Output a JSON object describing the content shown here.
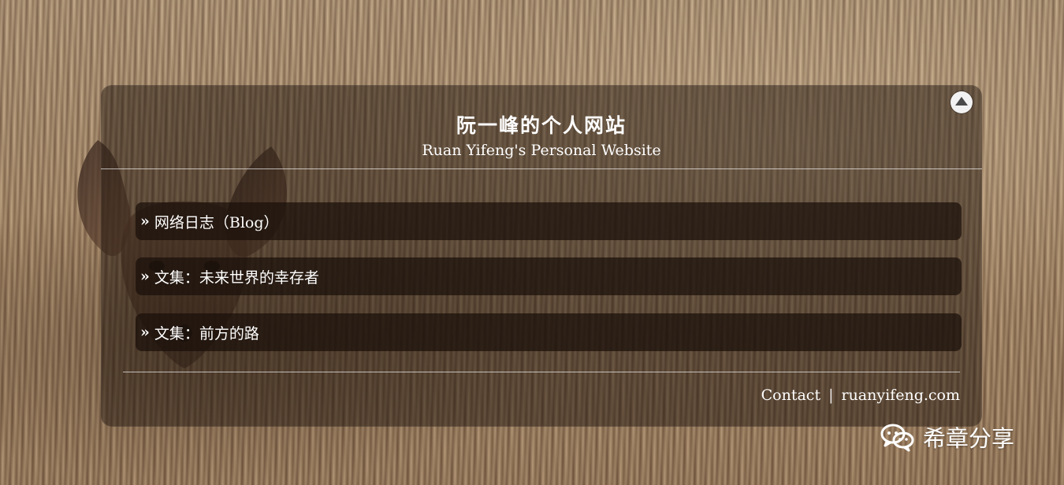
{
  "site": {
    "title": "阮一峰的个人网站",
    "subtitle": "Ruan Yifeng's Personal Website"
  },
  "menu": [
    {
      "arrow": "»",
      "label": "网络日志（Blog）"
    },
    {
      "arrow": "»",
      "label": "文集：未来世界的幸存者"
    },
    {
      "arrow": "»",
      "label": "文集：前方的路"
    }
  ],
  "footer": {
    "contact": "Contact",
    "separator": "|",
    "domain": "ruanyifeng.com"
  },
  "watermark": {
    "text": "希章分享",
    "icon": "wechat-icon"
  },
  "icons": {
    "scroll_up": "up-triangle-circle-icon"
  },
  "colors": {
    "panel_bg": "#1e120c",
    "text": "#ffffff"
  }
}
